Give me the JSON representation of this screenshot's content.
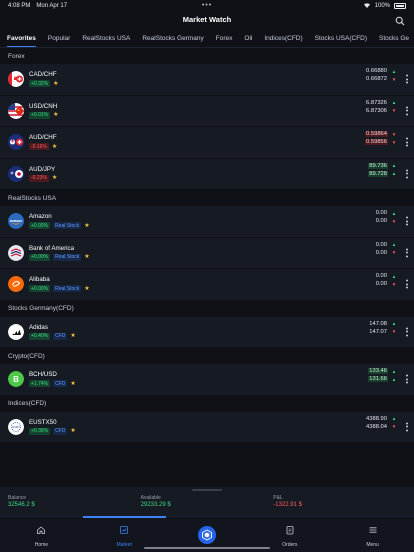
{
  "status": {
    "time": "4:08 PM",
    "date": "Mon Apr 17",
    "battery": "100%"
  },
  "title": "Market Watch",
  "tabs": [
    {
      "label": "Favorites",
      "active": true
    },
    {
      "label": "Popular"
    },
    {
      "label": "RealStocks USA"
    },
    {
      "label": "RealStocks Germany"
    },
    {
      "label": "Forex"
    },
    {
      "label": "Oil"
    },
    {
      "label": "Indices(CFD)"
    },
    {
      "label": "Stocks USA(CFD)"
    },
    {
      "label": "Stocks Ge"
    }
  ],
  "sections": [
    {
      "name": "Forex",
      "rows": [
        {
          "symbol": "CAD/CHF",
          "change": "+0.32%",
          "direction": "up",
          "tag": "",
          "icon": "cad-chf-flag-icon",
          "bid": "0.66880",
          "ask": "0.66872",
          "bid_dir": "up",
          "ask_dir": "down",
          "highlight": ""
        },
        {
          "symbol": "USD/CNH",
          "change": "+0.01%",
          "direction": "up",
          "tag": "",
          "icon": "usd-cnh-flag-icon",
          "bid": "6.87326",
          "ask": "6.87306",
          "bid_dir": "up",
          "ask_dir": "down",
          "highlight": ""
        },
        {
          "symbol": "AUD/CHF",
          "change": "-0.16%",
          "direction": "down",
          "tag": "",
          "icon": "aud-chf-flag-icon",
          "bid": "0.59864",
          "ask": "0.59856",
          "bid_dir": "down",
          "ask_dir": "down",
          "highlight": "down"
        },
        {
          "symbol": "AUD/JPY",
          "change": "-0.23%",
          "direction": "down",
          "tag": "",
          "icon": "aud-jpy-flag-icon",
          "bid": "89.736",
          "ask": "89.728",
          "bid_dir": "up",
          "ask_dir": "up",
          "highlight": "up"
        }
      ]
    },
    {
      "name": "RealStocks USA",
      "rows": [
        {
          "symbol": "Amazon",
          "change": "+0.00%",
          "direction": "up",
          "tag": "Real Stock",
          "icon": "amazon-logo-icon",
          "bid": "0.00",
          "ask": "0.00",
          "bid_dir": "up",
          "ask_dir": "down",
          "highlight": ""
        },
        {
          "symbol": "Bank of America",
          "change": "+0.00%",
          "direction": "up",
          "tag": "Real Stock",
          "icon": "bank-of-america-logo-icon",
          "bid": "0.00",
          "ask": "0.00",
          "bid_dir": "up",
          "ask_dir": "down",
          "highlight": ""
        },
        {
          "symbol": "Alibaba",
          "change": "+0.00%",
          "direction": "up",
          "tag": "Real Stock",
          "icon": "alibaba-logo-icon",
          "bid": "0.00",
          "ask": "0.00",
          "bid_dir": "up",
          "ask_dir": "down",
          "highlight": ""
        }
      ]
    },
    {
      "name": "Stocks Germany(CFD)",
      "rows": [
        {
          "symbol": "Adidas",
          "change": "+0.40%",
          "direction": "up",
          "tag": "CFD",
          "icon": "adidas-logo-icon",
          "bid": "147.08",
          "ask": "147.07",
          "bid_dir": "up",
          "ask_dir": "down",
          "highlight": ""
        }
      ]
    },
    {
      "name": "Crypto(CFD)",
      "rows": [
        {
          "symbol": "BCH/USD",
          "change": "+1.74%",
          "direction": "up",
          "tag": "CFD",
          "icon": "bitcoin-cash-logo-icon",
          "bid": "133.46",
          "ask": "131.66",
          "bid_dir": "up",
          "ask_dir": "up",
          "highlight": "up"
        }
      ]
    },
    {
      "name": "Indices(CFD)",
      "rows": [
        {
          "symbol": "EUSTX50",
          "change": "+0.36%",
          "direction": "up",
          "tag": "CFD",
          "icon": "eu-flag-icon",
          "bid": "4388.90",
          "ask": "4388.04",
          "bid_dir": "up",
          "ask_dir": "down",
          "highlight": ""
        }
      ]
    }
  ],
  "account": {
    "balance_label": "Balance",
    "balance": "32546.2 $",
    "available_label": "Available",
    "available": "29233.29 $",
    "pnl_label": "P&L",
    "pnl": "-1322.91 $"
  },
  "nav": [
    {
      "label": "Home",
      "icon": "home-icon"
    },
    {
      "label": "Market",
      "icon": "market-icon",
      "active": true
    },
    {
      "label": "",
      "icon": "trade-icon",
      "center": true
    },
    {
      "label": "Orders",
      "icon": "orders-icon"
    },
    {
      "label": "Menu",
      "icon": "menu-icon"
    }
  ],
  "colors": {
    "accent": "#3b82f6",
    "up": "#3ddc84",
    "down": "#ff5a5f",
    "star": "#f5c542",
    "background": "#0f1117",
    "row": "#161a23"
  }
}
